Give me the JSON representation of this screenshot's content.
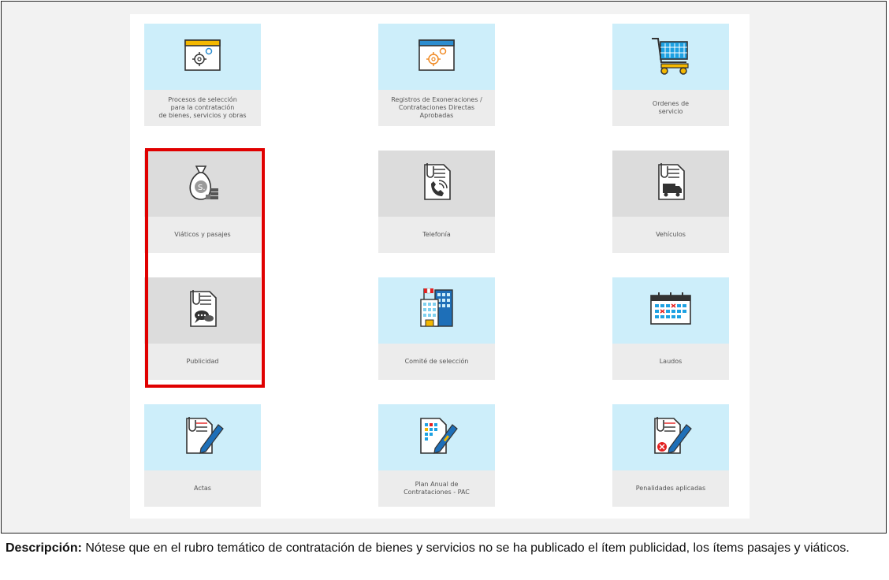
{
  "tiles": [
    {
      "label": "Procesos de selección\npara la contratación\nde bienes, servicios y obras",
      "icon": "gear-window-icon",
      "theme": "blue"
    },
    {
      "label": "Registros de Exoneraciones /\nContrataciones Directas\nAprobadas",
      "icon": "gear-window-icon",
      "theme": "blue"
    },
    {
      "label": "Ordenes de\nservicio",
      "icon": "shopping-cart-icon",
      "theme": "blue"
    },
    {
      "label": "Viáticos y pasajes",
      "icon": "money-bag-icon",
      "theme": "grey"
    },
    {
      "label": "Telefonía",
      "icon": "document-phone-icon",
      "theme": "grey"
    },
    {
      "label": "Vehículos",
      "icon": "document-truck-icon",
      "theme": "grey"
    },
    {
      "label": "Publicidad",
      "icon": "document-chat-icon",
      "theme": "grey"
    },
    {
      "label": "Comité de selección",
      "icon": "building-icon",
      "theme": "blue"
    },
    {
      "label": "Laudos",
      "icon": "calendar-icon",
      "theme": "blue"
    },
    {
      "label": "Actas",
      "icon": "document-pen-icon",
      "theme": "blue"
    },
    {
      "label": "Plan Anual de\nContrataciones - PAC",
      "icon": "document-grid-pen-icon",
      "theme": "blue"
    },
    {
      "label": "Penalidades aplicadas",
      "icon": "document-penalty-pen-icon",
      "theme": "blue"
    }
  ],
  "caption": {
    "prefix": "Descripción:",
    "text": " Nótese que en el rubro temático de contratación de bienes y servicios no se ha publicado el ítem publicidad, los ítems pasajes y viáticos."
  }
}
